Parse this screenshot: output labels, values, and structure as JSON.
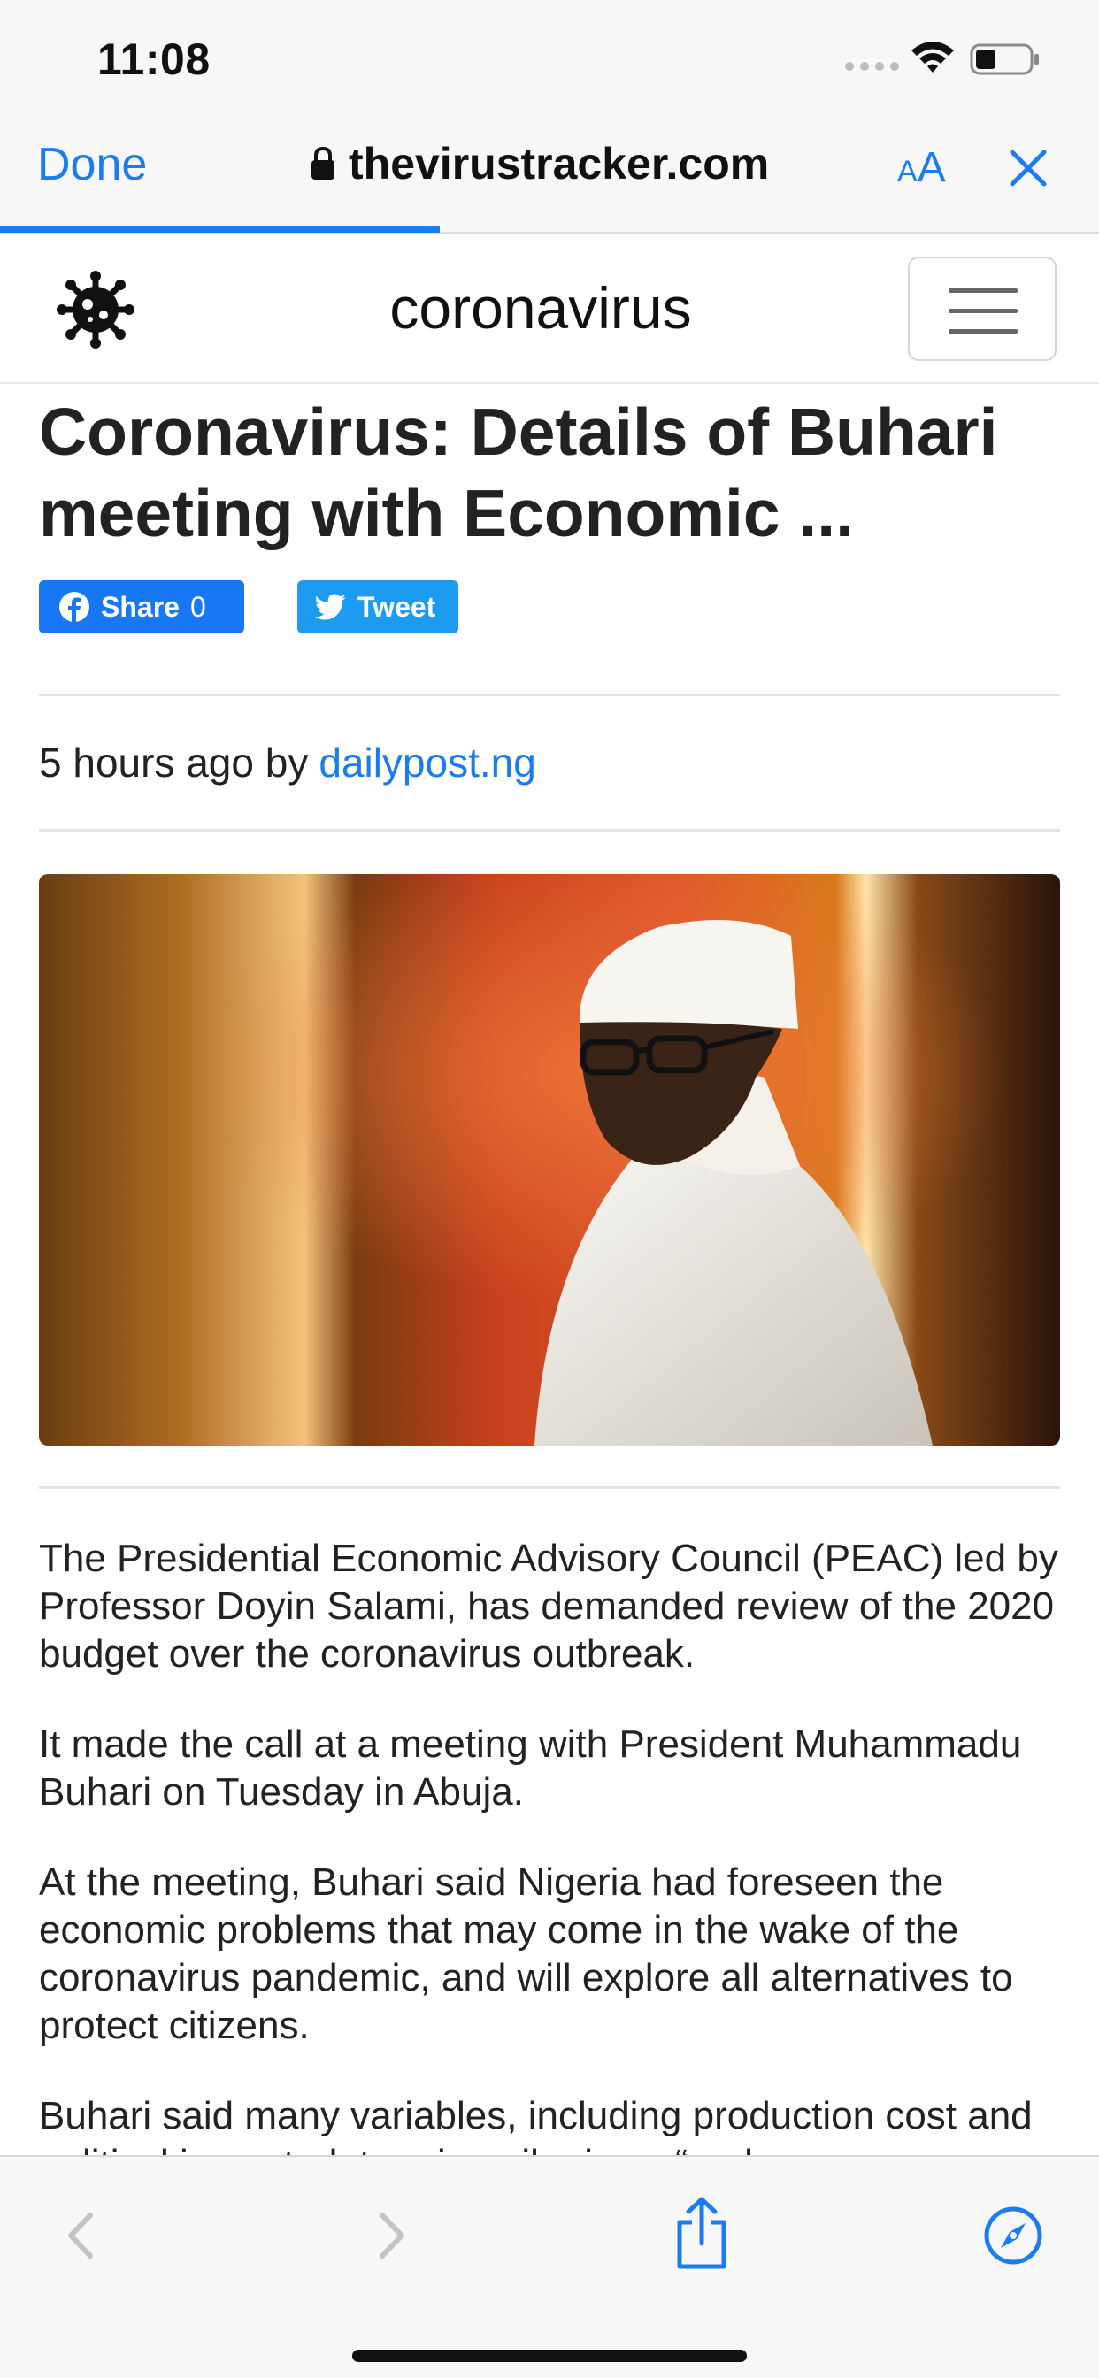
{
  "status": {
    "time": "11:08"
  },
  "browser": {
    "done_label": "Done",
    "url": "thevirustracker.com",
    "text_size_label_small": "A",
    "text_size_label_large": "A",
    "load_progress": 0.4
  },
  "site": {
    "title": "coronavirus"
  },
  "article": {
    "headline": "Coronavirus: Details of Buhari meeting with Economic ...",
    "share": {
      "facebook_label": "Share",
      "facebook_count": "0",
      "twitter_label": "Tweet"
    },
    "meta": {
      "prefix": "5 hours ago by",
      "source": "dailypost.ng"
    },
    "paragraphs": [
      "The Presidential Economic Advisory Council (PEAC) led by Professor Doyin Salami, has demanded review of the 2020 budget over the coronavirus outbreak.",
      "It made the call at a meeting with President Muhammadu Buhari on Tuesday in Abuja.",
      "At the meeting, Buhari said Nigeria had foreseen the economic problems that may come in the wake of the coronavirus pandemic, and will explore all alternatives to protect citizens.",
      "Buhari said many variables, including production cost and political impact, determine oil prices, “and we"
    ]
  },
  "toolbar": {
    "icons": [
      "back-icon",
      "forward-icon",
      "share-icon",
      "compass-icon"
    ]
  }
}
